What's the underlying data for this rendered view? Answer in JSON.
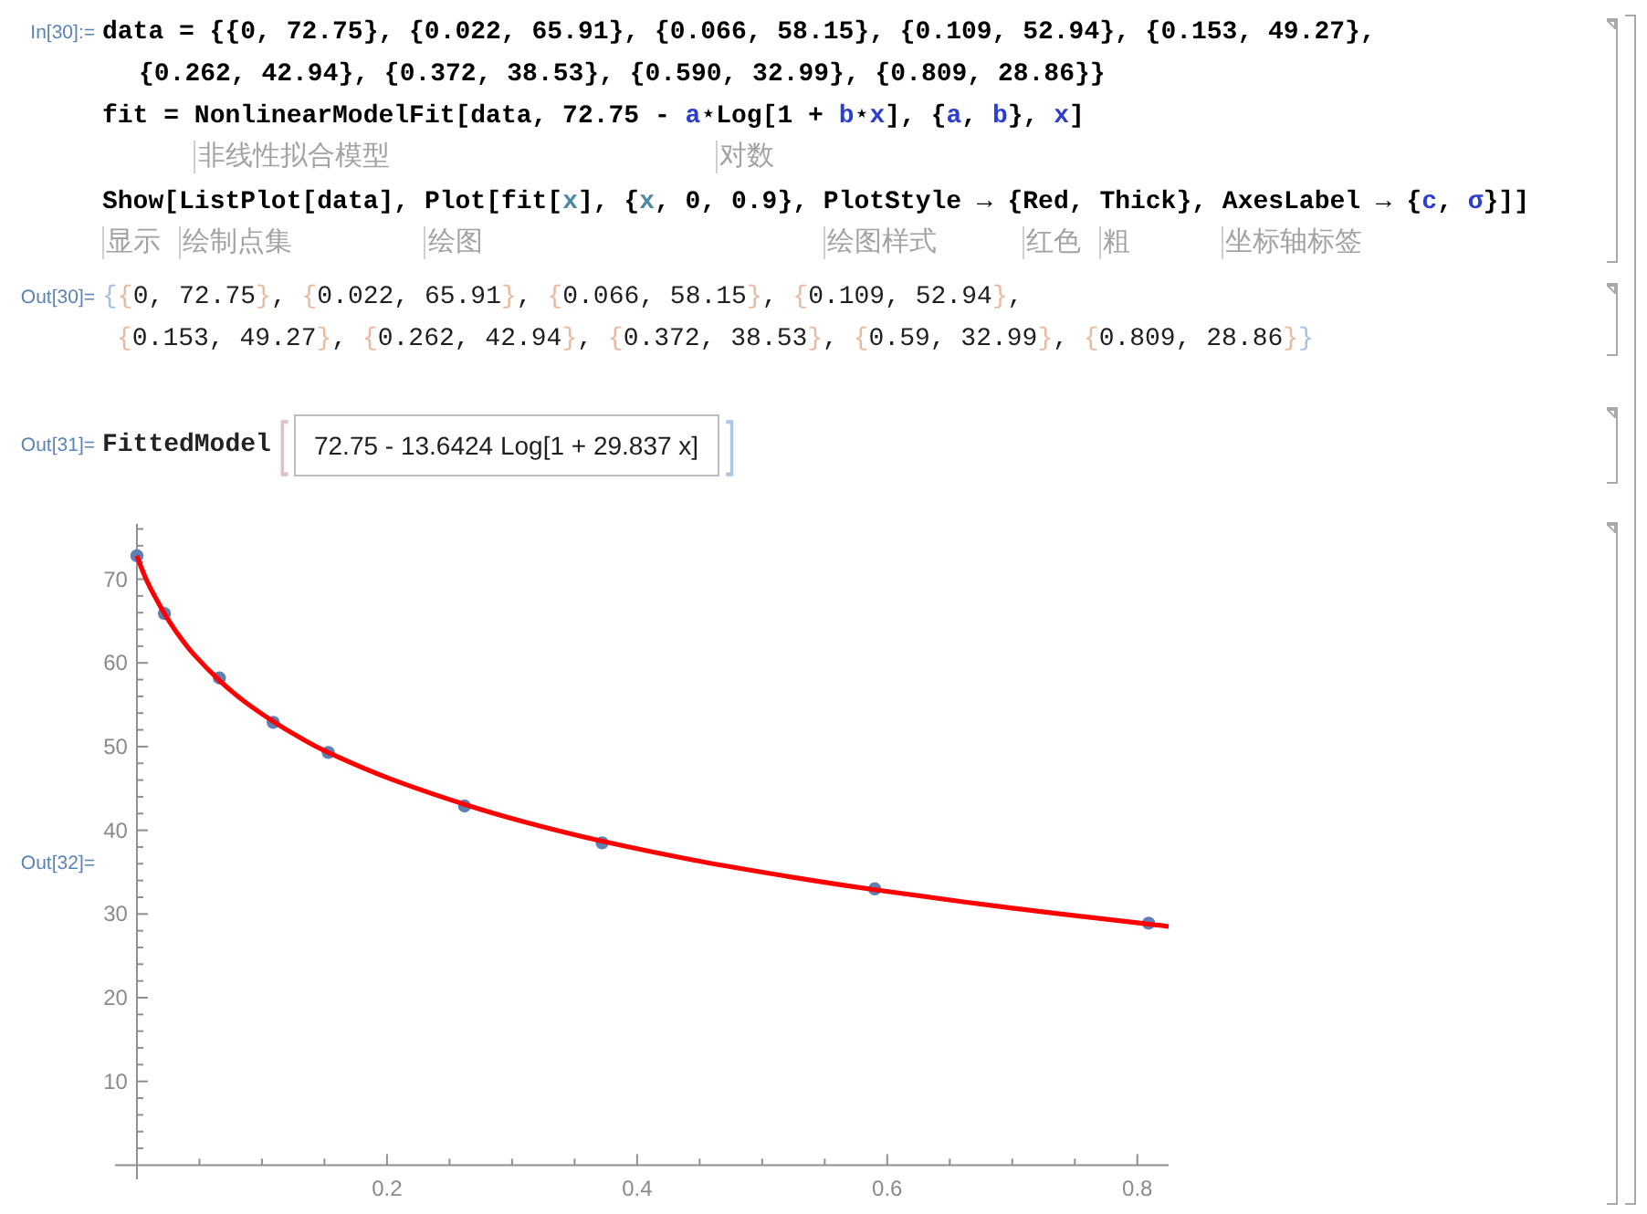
{
  "cells": [
    {
      "kind": "input",
      "label": "In[30]:=",
      "lines": [
        {
          "kind": "first",
          "tokens": [
            {
              "text": "data = {{0, 72.75}, {0.022, 65.91}, {0.066, 58.15}, {0.109, 52.94}, {0.153, 49.27},",
              "kind": "plain"
            }
          ]
        },
        {
          "kind": "continuation",
          "tokens": [
            {
              "text": "{0.262, 42.94}, {0.372, 38.53}, {0.590, 32.99}, {0.809, 28.86}}",
              "kind": "plain"
            }
          ]
        },
        {
          "kind": "first",
          "tokens": [
            {
              "text": "fit = ",
              "kind": "plain"
            },
            {
              "text": "NonlinearModelFit",
              "kind": "plain",
              "hint": "非线性拟合模型"
            },
            {
              "text": "[data, 72.75 - ",
              "kind": "plain"
            },
            {
              "text": "a",
              "kind": "symbol"
            },
            {
              "text": "⋆",
              "kind": "plain"
            },
            {
              "text": "Log",
              "kind": "plain",
              "hint": "对数"
            },
            {
              "text": "[1 + ",
              "kind": "plain"
            },
            {
              "text": "b",
              "kind": "symbol"
            },
            {
              "text": "⋆",
              "kind": "plain"
            },
            {
              "text": "x",
              "kind": "symbol"
            },
            {
              "text": "], {",
              "kind": "plain"
            },
            {
              "text": "a",
              "kind": "symbol"
            },
            {
              "text": ", ",
              "kind": "plain"
            },
            {
              "text": "b",
              "kind": "symbol"
            },
            {
              "text": "}, ",
              "kind": "plain"
            },
            {
              "text": "x",
              "kind": "symbol"
            },
            {
              "text": "]",
              "kind": "plain"
            }
          ]
        },
        {
          "kind": "first",
          "tokens": [
            {
              "text": "Show",
              "kind": "plain",
              "hint": "显示"
            },
            {
              "text": "[",
              "kind": "plain"
            },
            {
              "text": "ListPlot",
              "kind": "plain",
              "hint": "绘制点集"
            },
            {
              "text": "[data], ",
              "kind": "plain"
            },
            {
              "text": "Plot",
              "kind": "plain",
              "hint": "绘图"
            },
            {
              "text": "[fit[",
              "kind": "plain"
            },
            {
              "text": "x",
              "kind": "local"
            },
            {
              "text": "], {",
              "kind": "plain"
            },
            {
              "text": "x",
              "kind": "local"
            },
            {
              "text": ", 0, 0.9}, ",
              "kind": "plain"
            },
            {
              "text": "PlotStyle",
              "kind": "plain",
              "hint": "绘图样式"
            },
            {
              "text": " → {",
              "kind": "plain"
            },
            {
              "text": "Red",
              "kind": "plain",
              "hint": "红色"
            },
            {
              "text": ", ",
              "kind": "plain"
            },
            {
              "text": "Thick",
              "kind": "plain",
              "hint": "粗"
            },
            {
              "text": "}, ",
              "kind": "plain"
            },
            {
              "text": "AxesLabel",
              "kind": "plain",
              "hint": "坐标轴标签"
            },
            {
              "text": " → {",
              "kind": "plain"
            },
            {
              "text": "c",
              "kind": "symbol"
            },
            {
              "text": ", ",
              "kind": "plain"
            },
            {
              "text": "σ",
              "kind": "symbol"
            },
            {
              "text": "}]]",
              "kind": "plain"
            }
          ]
        }
      ]
    },
    {
      "kind": "output",
      "label": "Out[30]=",
      "lines": [
        {
          "kind": "first",
          "tokens": [
            {
              "text": "{",
              "kind": "brace_outer"
            },
            {
              "text": "{",
              "kind": "brace_inner"
            },
            {
              "text": "0, 72.75",
              "kind": "plain"
            },
            {
              "text": "}",
              "kind": "brace_inner"
            },
            {
              "text": ", ",
              "kind": "plain"
            },
            {
              "text": "{",
              "kind": "brace_inner"
            },
            {
              "text": "0.022, 65.91",
              "kind": "plain"
            },
            {
              "text": "}",
              "kind": "brace_inner"
            },
            {
              "text": ", ",
              "kind": "plain"
            },
            {
              "text": "{",
              "kind": "brace_inner"
            },
            {
              "text": "0.066, 58.15",
              "kind": "plain"
            },
            {
              "text": "}",
              "kind": "brace_inner"
            },
            {
              "text": ", ",
              "kind": "plain"
            },
            {
              "text": "{",
              "kind": "brace_inner"
            },
            {
              "text": "0.109, 52.94",
              "kind": "plain"
            },
            {
              "text": "}",
              "kind": "brace_inner"
            },
            {
              "text": ",",
              "kind": "plain"
            }
          ]
        },
        {
          "kind": "continuation",
          "tokens": [
            {
              "text": "{",
              "kind": "brace_inner"
            },
            {
              "text": "0.153, 49.27",
              "kind": "plain"
            },
            {
              "text": "}",
              "kind": "brace_inner"
            },
            {
              "text": ", ",
              "kind": "plain"
            },
            {
              "text": "{",
              "kind": "brace_inner"
            },
            {
              "text": "0.262, 42.94",
              "kind": "plain"
            },
            {
              "text": "}",
              "kind": "brace_inner"
            },
            {
              "text": ", ",
              "kind": "plain"
            },
            {
              "text": "{",
              "kind": "brace_inner"
            },
            {
              "text": "0.372, 38.53",
              "kind": "plain"
            },
            {
              "text": "}",
              "kind": "brace_inner"
            },
            {
              "text": ", ",
              "kind": "plain"
            },
            {
              "text": "{",
              "kind": "brace_inner"
            },
            {
              "text": "0.59, 32.99",
              "kind": "plain"
            },
            {
              "text": "}",
              "kind": "brace_inner"
            },
            {
              "text": ", ",
              "kind": "plain"
            },
            {
              "text": "{",
              "kind": "brace_inner"
            },
            {
              "text": "0.809, 28.86",
              "kind": "plain"
            },
            {
              "text": "}",
              "kind": "brace_inner"
            },
            {
              "text": "}",
              "kind": "brace_outer"
            }
          ]
        }
      ]
    },
    {
      "kind": "model",
      "label": "Out[31]=",
      "head": "FittedModel",
      "open_bracket": "[",
      "formula": "72.75 - 13.6424 Log[1 + 29.837 x]",
      "close_bracket": "]"
    },
    {
      "kind": "plot",
      "label": "Out[32]=",
      "chart_data": {
        "type": "scatter",
        "x": [
          0,
          0.004,
          0.008,
          0.013,
          0.022,
          0.032,
          0.045,
          0.066,
          0.085,
          0.109,
          0.13,
          0.153,
          0.2,
          0.262,
          0.31,
          0.372,
          0.45,
          0.52,
          0.59,
          0.7,
          0.809,
          0.825
        ],
        "series": [
          {
            "type": "scatter",
            "color": "#5e81b5",
            "values": [
              72.8,
              null,
              null,
              null,
              65.9,
              null,
              null,
              58.2,
              null,
              52.9,
              null,
              49.3,
              null,
              42.9,
              null,
              38.5,
              null,
              null,
              33.0,
              null,
              28.9,
              null
            ]
          },
          {
            "type": "line",
            "color": "#ff0000",
            "values": [
              72.8,
              71.2,
              69.8,
              68.3,
              65.9,
              63.6,
              61.1,
              57.9,
              55.5,
              53.0,
              51.1,
              49.3,
              46.3,
              43.1,
              41.0,
              38.7,
              36.3,
              34.5,
              32.9,
              30.7,
              28.8,
              28.5
            ]
          }
        ],
        "xlim": [
          -0.0175,
          0.825
        ],
        "ylim": [
          -1.7,
          76.6
        ],
        "xticks": [
          0.2,
          0.4,
          0.6,
          0.8
        ],
        "yticks": [
          10,
          20,
          30,
          40,
          50,
          60,
          70
        ]
      }
    }
  ]
}
